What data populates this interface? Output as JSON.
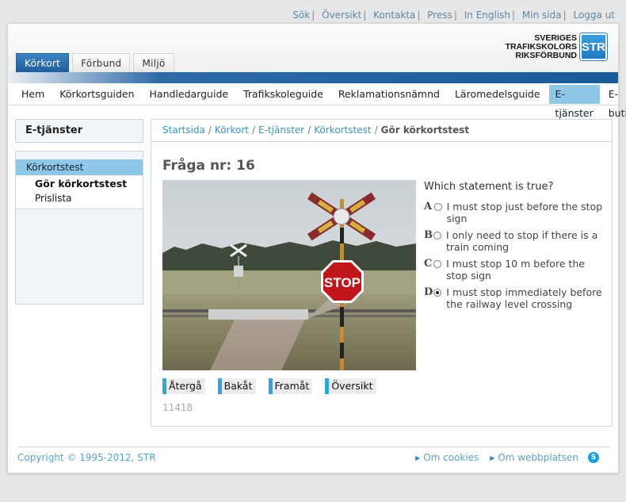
{
  "utility_links": [
    "Sök",
    "Översikt",
    "Kontakta",
    "Press",
    "In English",
    "Min sida",
    "Logga ut"
  ],
  "tabs": [
    {
      "label": "Körkort",
      "active": true
    },
    {
      "label": "Förbund",
      "active": false
    },
    {
      "label": "Miljö",
      "active": false
    }
  ],
  "logo": {
    "line1": "SVERIGES",
    "line2": "TRAFIKSKOLORS",
    "line3": "RIKSFÖRBUND",
    "mark": "STR"
  },
  "main_nav": [
    {
      "label": "Hem",
      "active": false
    },
    {
      "label": "Körkortsguiden",
      "active": false
    },
    {
      "label": "Handledarguide",
      "active": false
    },
    {
      "label": "Trafikskoleguide",
      "active": false
    },
    {
      "label": "Reklamationsnämnd",
      "active": false
    },
    {
      "label": "Läromedelsguide",
      "active": false
    },
    {
      "label": "E-tjänster",
      "active": true
    },
    {
      "label": "E-butik",
      "active": false
    }
  ],
  "sidebar": {
    "title": "E-tjänster",
    "item": "Körkortstest",
    "subitems": [
      "Gör körkortstest",
      "Prislista"
    ]
  },
  "breadcrumb": {
    "items": [
      "Startsida",
      "Körkort",
      "E-tjänster",
      "Körkortstest"
    ],
    "current": "Gör körkortstest"
  },
  "quiz": {
    "title": "Fråga nr: 16",
    "question": "Which statement is true?",
    "options": [
      {
        "letter": "A",
        "text": "I must stop just before the stop sign",
        "selected": false
      },
      {
        "letter": "B",
        "text": "I only need to stop if there is a train coming",
        "selected": false
      },
      {
        "letter": "C",
        "text": "I must stop 10 m before the stop sign",
        "selected": false
      },
      {
        "letter": "D",
        "text": "I must stop immediately before the railway level crossing",
        "selected": true
      }
    ],
    "stop_sign_text": "STOP",
    "buttons": [
      "Återgå",
      "Bakåt",
      "Framåt",
      "Översikt"
    ],
    "code": "11418"
  },
  "footer": {
    "copyright": "Copyright © 1995-2012, STR",
    "links": [
      "Om cookies",
      "Om webbplatsen"
    ]
  },
  "colors": {
    "brand_blue": "#1b5a98",
    "accent_light": "#8fc7e8",
    "link": "#3b93c8"
  }
}
